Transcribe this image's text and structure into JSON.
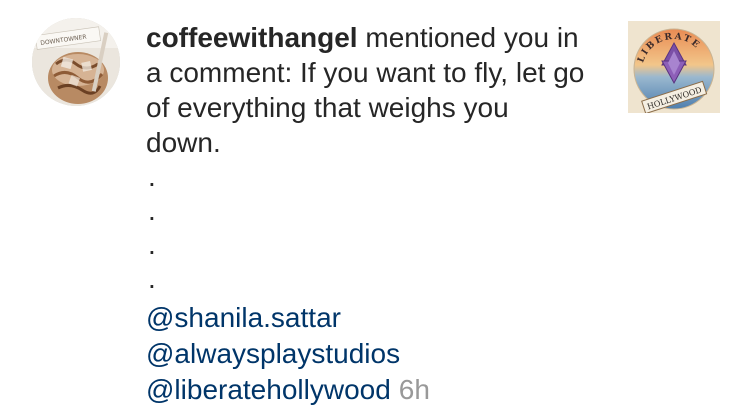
{
  "notification": {
    "username": "coffeewithangel",
    "action_text": " mentioned you in",
    "comment_lines": [
      "a comment: If you want to fly, let go",
      "of everything that weighs you",
      "down."
    ],
    "dots": [
      ".",
      ".",
      ".",
      "."
    ],
    "mentions": [
      "@shanila.sattar",
      "@alwaysplaystudios",
      "@liberatehollywood"
    ],
    "timestamp": "6h"
  },
  "avatar": {
    "icon": "coffee-drink-photo",
    "sign_text": "DOWNTOWNER"
  },
  "post_thumbnail": {
    "icon": "star-of-david-emblem",
    "arc_text": "LIBERATE",
    "banner_text": "HOLLYWOOD"
  },
  "colors": {
    "text": "#262626",
    "mention": "#003569",
    "timestamp": "#999999"
  }
}
